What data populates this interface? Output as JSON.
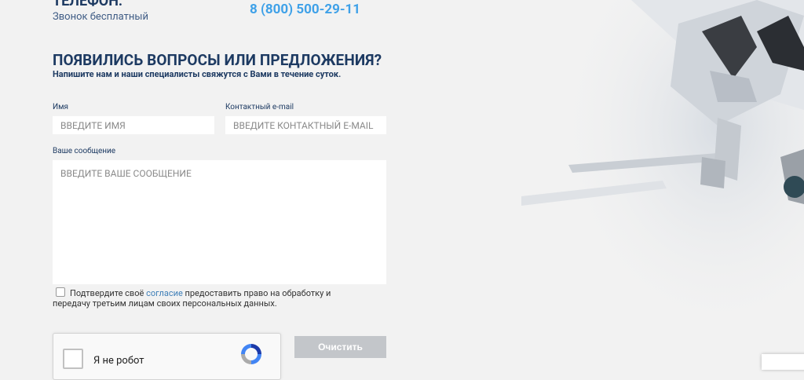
{
  "contact": {
    "phone_title": "ТЕЛЕФОН:",
    "phone_subtitle": "Звонок бесплатный",
    "phone_number": "8 (800) 500-29-11"
  },
  "form": {
    "title": "ПОЯВИЛИСЬ ВОПРОСЫ ИЛИ ПРЕДЛОЖЕНИЯ?",
    "subtitle": "Напишите нам и наши специалисты свяжутся с Вами в течение суток.",
    "name_label": "Имя",
    "name_placeholder": "ВВЕДИТЕ ИМЯ",
    "email_label": "Контактный e-mail",
    "email_placeholder": "ВВЕДИТЕ КОНТАКТНЫЙ E-MAIL",
    "message_label": "Ваше сообщение",
    "message_placeholder": "ВВЕДИТЕ ВАШЕ СООБЩЕНИЕ",
    "consent_before": "Подтвердите своё ",
    "consent_link": "согласие",
    "consent_after": " предоставить право на обработку и передачу третьим лицам своих персональных данных.",
    "consent_checked": false,
    "captcha_text": "Я не робот",
    "clear_button": "Очистить"
  },
  "colors": {
    "accent": "#3fa1e8",
    "heading": "#1d3a62",
    "button": "#c3c6ca"
  }
}
